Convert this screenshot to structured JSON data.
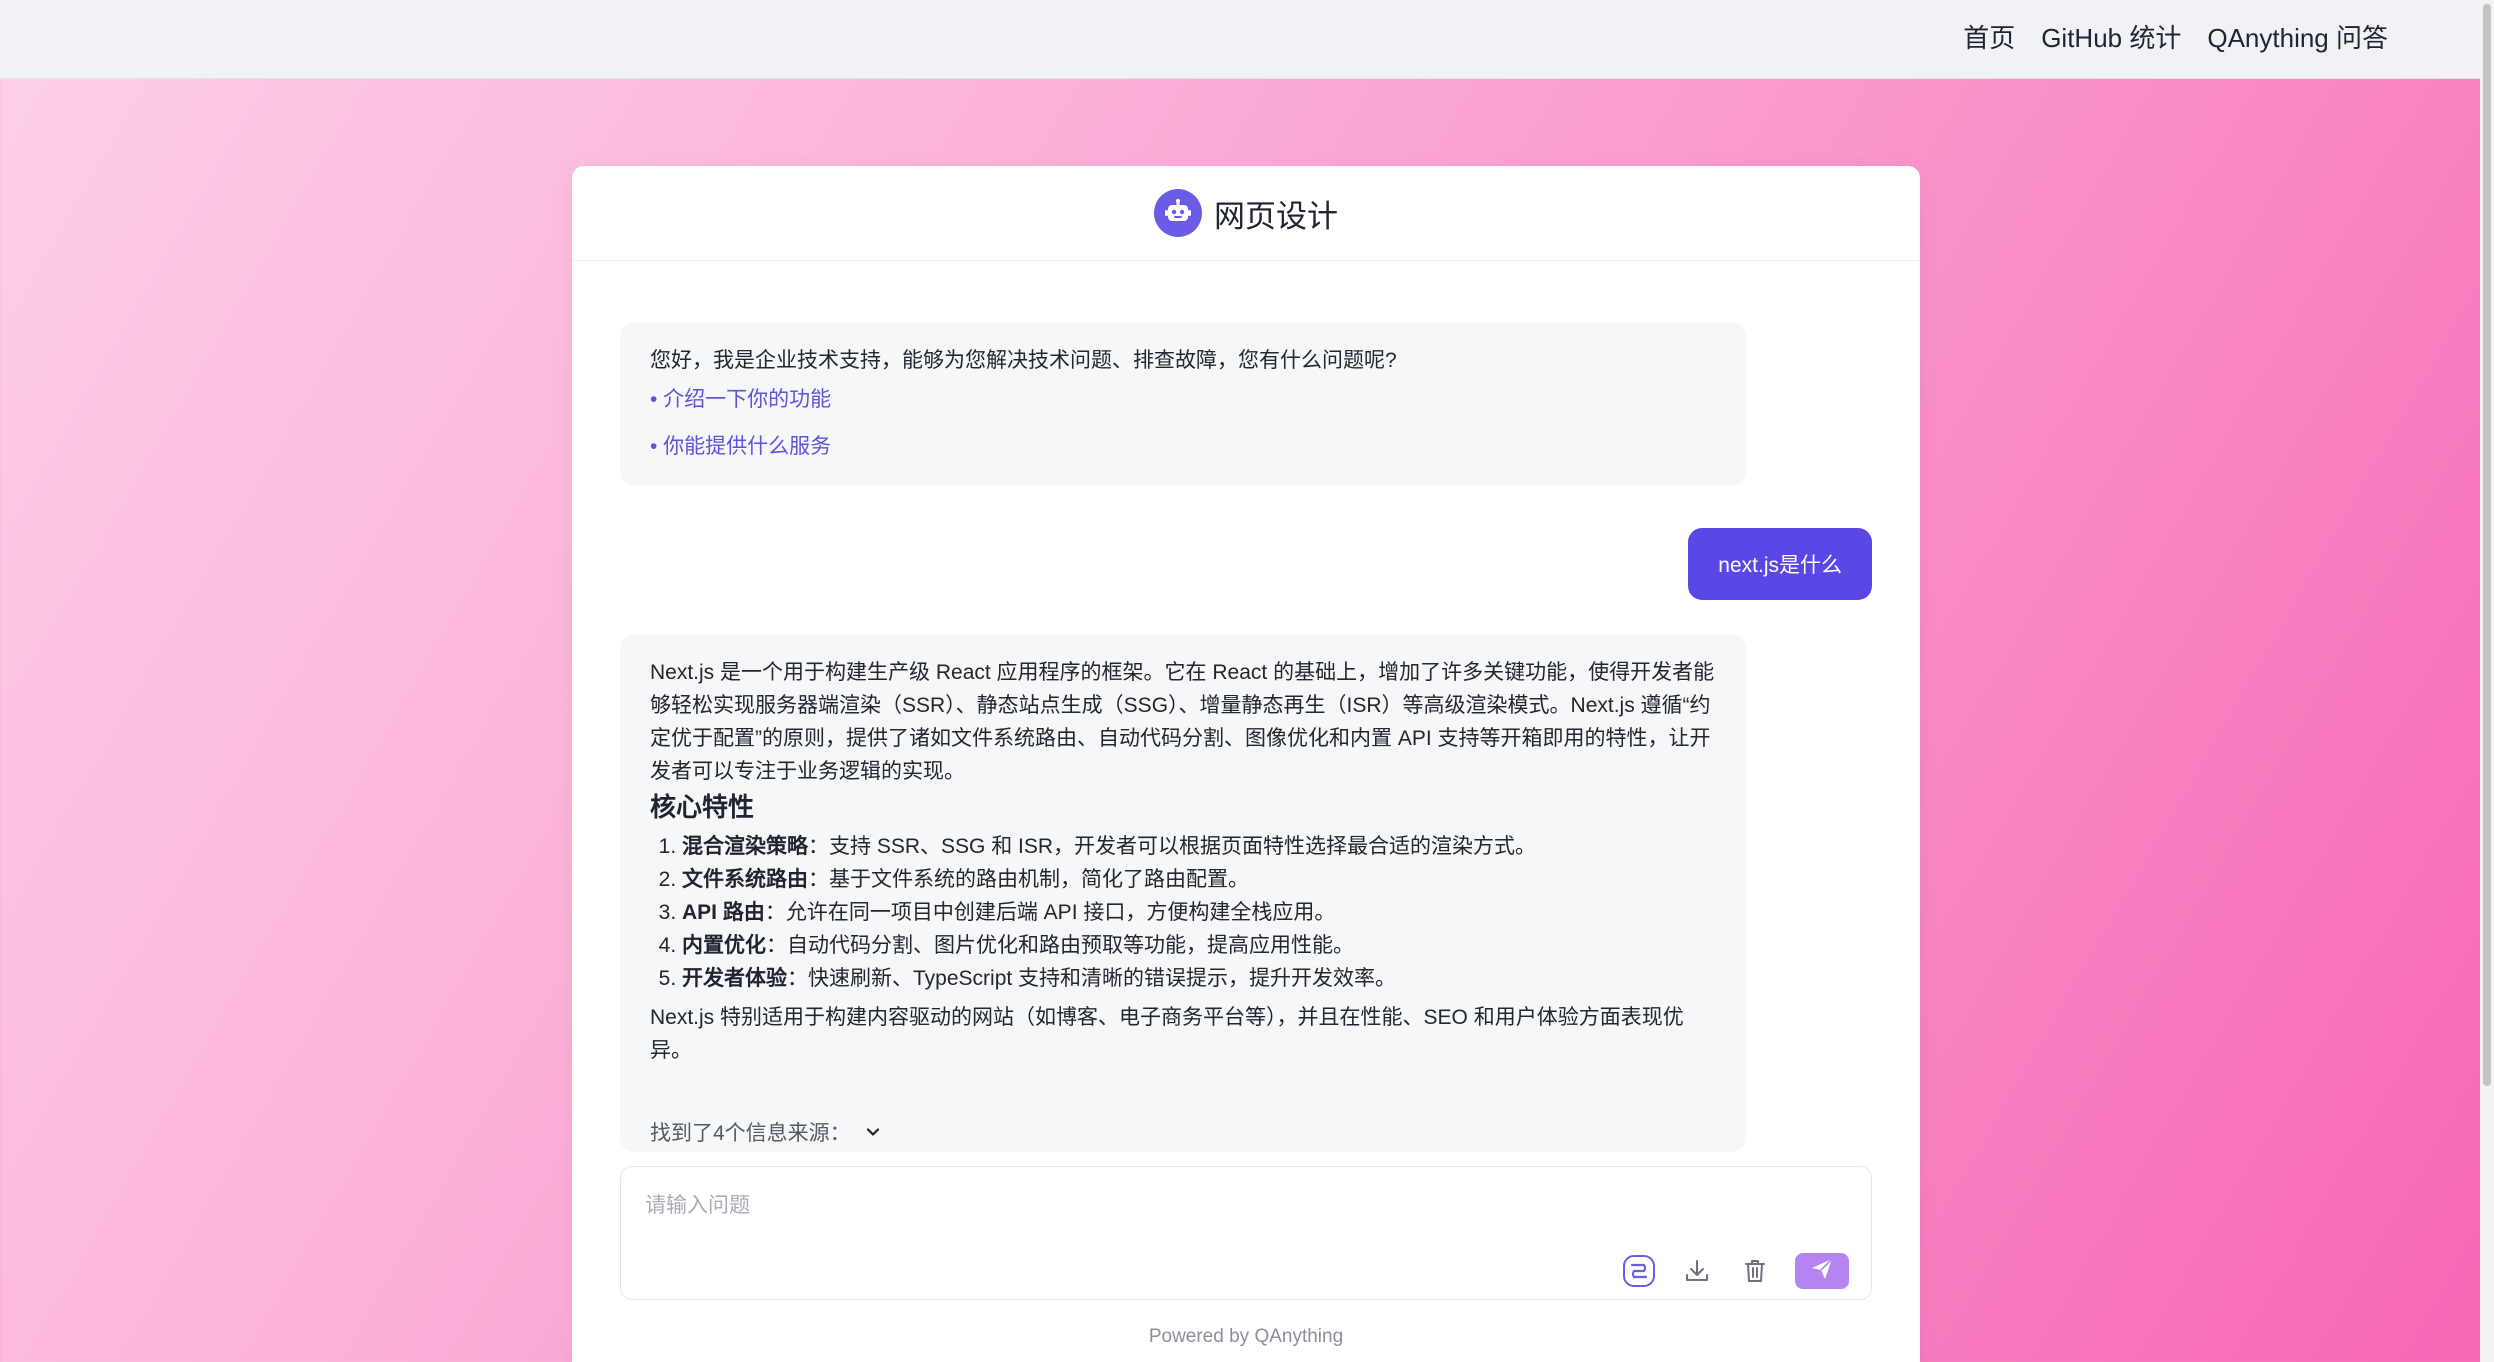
{
  "nav": {
    "home": "首页",
    "github": "GitHub 统计",
    "qa": "QAnything 问答"
  },
  "chat": {
    "title": "网页设计",
    "greeting": {
      "text": "您好，我是企业技术支持，能够为您解决技术问题、排查故障，您有什么问题呢?",
      "suggestions": [
        "• 介绍一下你的功能",
        "• 你能提供什么服务"
      ]
    },
    "user_message": "next.js是什么",
    "answer": {
      "intro": "Next.js 是一个用于构建生产级 React 应用程序的框架。它在 React 的基础上，增加了许多关键功能，使得开发者能够轻松实现服务器端渲染（SSR）、静态站点生成（SSG）、增量静态再生（ISR）等高级渲染模式。Next.js 遵循“约定优于配置”的原则，提供了诸如文件系统路由、自动代码分割、图像优化和内置 API 支持等开箱即用的特性，让开发者可以专注于业务逻辑的实现。",
      "heading": "核心特性",
      "features": [
        {
          "title": "混合渲染策略",
          "desc": "：支持 SSR、SSG 和 ISR，开发者可以根据页面特性选择最合适的渲染方式。"
        },
        {
          "title": "文件系统路由",
          "desc": "：基于文件系统的路由机制，简化了路由配置。"
        },
        {
          "title": "API 路由",
          "desc": "：允许在同一项目中创建后端 API 接口，方便构建全栈应用。"
        },
        {
          "title": "内置优化",
          "desc": "：自动代码分割、图片优化和路由预取等功能，提高应用性能。"
        },
        {
          "title": "开发者体验",
          "desc": "：快速刷新、TypeScript 支持和清晰的错误提示，提升开发效率。"
        }
      ],
      "closing": "Next.js 特别适用于构建内容驱动的网站（如博客、电子商务平台等），并且在性能、SEO 和用户体验方面表现优异。",
      "sources": "找到了4个信息来源："
    },
    "input_placeholder": "请输入问题",
    "powered_by": "Powered by QAnything"
  },
  "icons": {
    "bot": "robot-icon",
    "sources_toggle": "chevron-down-icon",
    "tool1": "sparkle-icon",
    "tool2": "download-icon",
    "tool3": "trash-icon",
    "send": "send-icon"
  },
  "colors": {
    "accent": "#5a48e6",
    "link": "#6252d8",
    "send_button": "#b485f2"
  }
}
